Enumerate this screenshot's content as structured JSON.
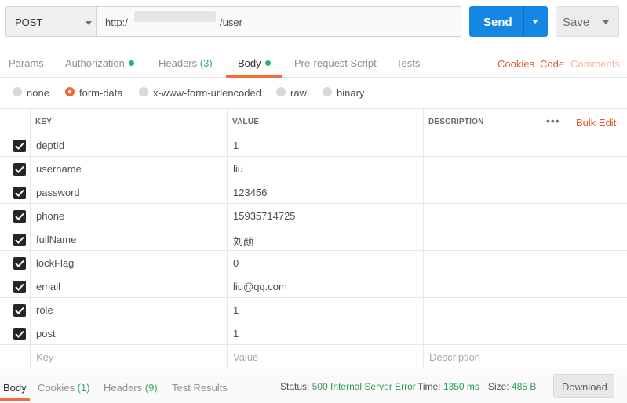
{
  "request": {
    "method": "POST",
    "url_prefix": "http:/",
    "url_suffix": "/user",
    "send_label": "Send",
    "save_label": "Save"
  },
  "tabs": [
    {
      "label": "Params"
    },
    {
      "label": "Authorization",
      "dot": true
    },
    {
      "label": "Headers",
      "count": "(3)"
    },
    {
      "label": "Body",
      "dot": true,
      "active": true
    },
    {
      "label": "Pre-request Script"
    },
    {
      "label": "Tests"
    }
  ],
  "right_links": {
    "cookies": "Cookies",
    "code": "Code",
    "comments": "Comments"
  },
  "body_types": [
    {
      "label": "none"
    },
    {
      "label": "form-data",
      "selected": true
    },
    {
      "label": "x-www-form-urlencoded"
    },
    {
      "label": "raw"
    },
    {
      "label": "binary"
    }
  ],
  "table": {
    "headers": {
      "key": "KEY",
      "value": "VALUE",
      "description": "DESCRIPTION"
    },
    "more_label": "•••",
    "bulk_edit": "Bulk Edit",
    "rows": [
      {
        "key": "deptId",
        "value": "1",
        "checked": true
      },
      {
        "key": "username",
        "value": "liu",
        "checked": true
      },
      {
        "key": "password",
        "value": "123456",
        "checked": true
      },
      {
        "key": "phone",
        "value": "15935714725",
        "checked": true
      },
      {
        "key": "fullName",
        "value": "刘颜",
        "checked": true
      },
      {
        "key": "lockFlag",
        "value": "0",
        "checked": true
      },
      {
        "key": "email",
        "value": "liu@qq.com",
        "checked": true
      },
      {
        "key": "role",
        "value": "1",
        "checked": true
      },
      {
        "key": "post",
        "value": "1",
        "checked": true
      }
    ],
    "placeholders": {
      "key": "Key",
      "value": "Value",
      "description": "Description"
    }
  },
  "response": {
    "tabs": [
      {
        "label": "Body",
        "active": true
      },
      {
        "label": "Cookies",
        "count": "(1)"
      },
      {
        "label": "Headers",
        "count": "(9)"
      },
      {
        "label": "Test Results"
      }
    ],
    "status_label": "Status:",
    "status_value": "500 Internal Server Error",
    "time_label": "Time:",
    "time_value": "1350 ms",
    "size_label": "Size:",
    "size_value": "485 B",
    "download_label": "Download"
  },
  "colors": {
    "accent": "#f26b3a",
    "send": "#1686e5",
    "success_text": "#2a9a5a",
    "dot": "#2bb07a"
  }
}
